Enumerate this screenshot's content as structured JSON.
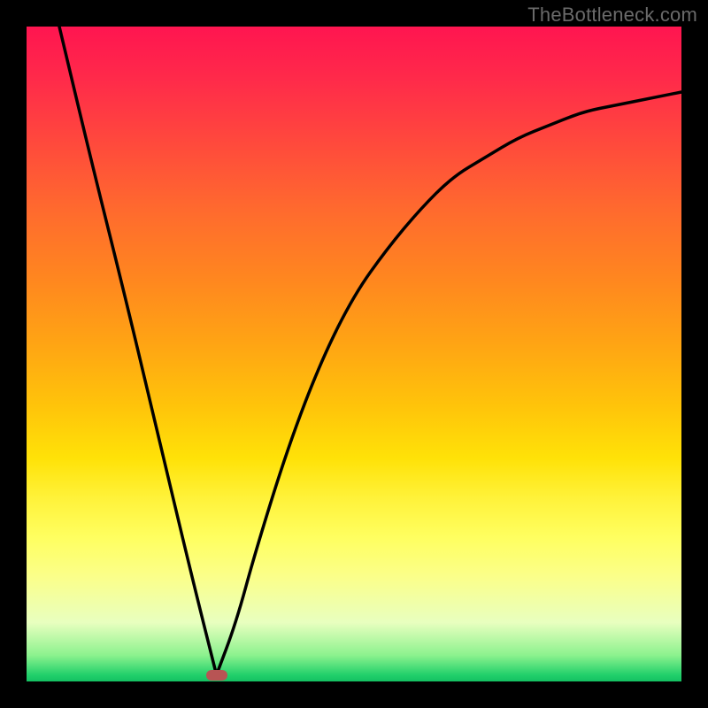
{
  "watermark": "TheBottleneck.com",
  "colors": {
    "frame": "#000000",
    "curve": "#000000",
    "dip_dot": "#b85454"
  },
  "chart_data": {
    "type": "line",
    "title": "",
    "xlabel": "",
    "ylabel": "",
    "xlim": [
      0,
      100
    ],
    "ylim": [
      0,
      100
    ],
    "grid": false,
    "legend": false,
    "note": "Values read from axes-less gradient plot; x is horizontal position (%), y is curve height (% of plot area from bottom). Two visual branches meeting at a single minimum (the dip).",
    "series": [
      {
        "name": "left-branch",
        "x": [
          5,
          10,
          15,
          20,
          25
        ],
        "values": [
          100,
          79,
          59,
          38,
          17
        ]
      },
      {
        "name": "right-branch",
        "x": [
          32,
          35,
          40,
          45,
          50,
          55,
          60,
          65,
          70,
          75,
          80,
          85,
          90,
          95,
          100
        ],
        "values": [
          9,
          20,
          36,
          49,
          59,
          66,
          72,
          77,
          80,
          83,
          85,
          87,
          88,
          89,
          90
        ]
      }
    ],
    "dip": {
      "x": 29,
      "y": 1
    }
  }
}
